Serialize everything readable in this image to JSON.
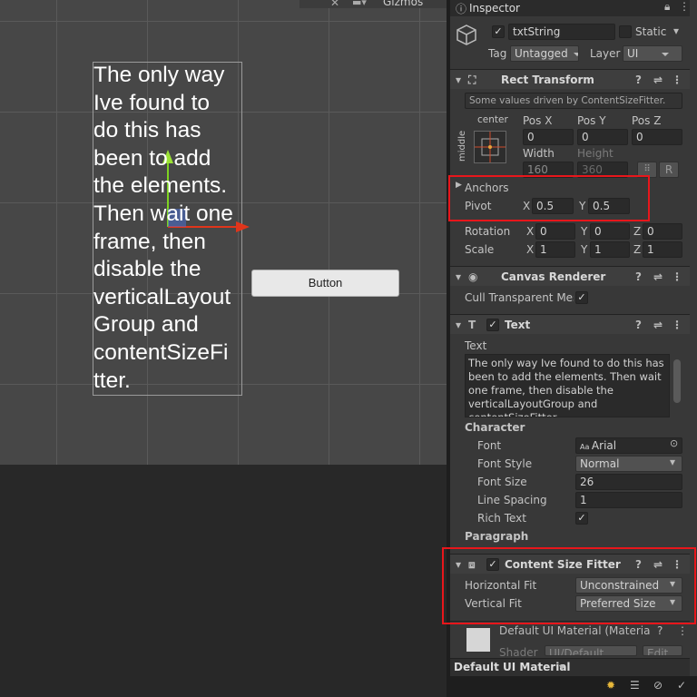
{
  "scene": {
    "toolbar_gizmos": "Gizmos",
    "text_content": "The only way Ive found to\ndo this has\nbeen to add\nthe elements.\nThen wait one\nframe, then\ndisable the\nverticalLayout\nGroup and\ncontentSizeFi\ntter.",
    "button_label": "Button"
  },
  "inspector": {
    "tab": "Inspector",
    "object_name": "txtString",
    "static_label": "Static",
    "tag_label": "Tag",
    "tag_value": "Untagged",
    "layer_label": "Layer",
    "layer_value": "UI",
    "rect": {
      "title": "Rect Transform",
      "note": "Some values driven by ContentSizeFitter.",
      "anchor_h": "center",
      "anchor_v": "middle",
      "posx_label": "Pos X",
      "posx": "0",
      "posy_label": "Pos Y",
      "posy": "0",
      "posz_label": "Pos Z",
      "posz": "0",
      "width_label": "Width",
      "width": "160",
      "height_label": "Height",
      "height": "360",
      "r_label": "R",
      "anchors_label": "Anchors",
      "pivot_label": "Pivot",
      "pivot_x": "0.5",
      "pivot_y": "0.5",
      "rotation_label": "Rotation",
      "rot_x": "0",
      "rot_y": "0",
      "rot_z": "0",
      "scale_label": "Scale",
      "scale_x": "1",
      "scale_y": "1",
      "scale_z": "1",
      "x": "X",
      "y": "Y",
      "z": "Z"
    },
    "canvas": {
      "title": "Canvas Renderer",
      "cull_label": "Cull Transparent Mes"
    },
    "text": {
      "title": "Text",
      "text_label": "Text",
      "text_value": "The only way Ive found to do this has been to add the elements. Then wait one frame, then disable the verticalLayoutGroup and contentSizeFitter.",
      "character_label": "Character",
      "font_label": "Font",
      "font_value": "Arial",
      "font_style_label": "Font Style",
      "font_style_value": "Normal",
      "font_size_label": "Font Size",
      "font_size_value": "26",
      "line_spacing_label": "Line Spacing",
      "line_spacing_value": "1",
      "rich_text_label": "Rich Text",
      "paragraph_label": "Paragraph"
    },
    "csf": {
      "title": "Content Size Fitter",
      "hfit_label": "Horizontal Fit",
      "hfit_value": "Unconstrained",
      "vfit_label": "Vertical Fit",
      "vfit_value": "Preferred Size"
    },
    "material": {
      "title": "Default UI Material (Materia",
      "shader_label": "Shader",
      "shader_value": "UI/Default",
      "edit_label": "Edit..."
    },
    "footer_material": "Default UI Material"
  },
  "colors": {
    "highlight": "#e8161b",
    "panel": "#383838"
  }
}
